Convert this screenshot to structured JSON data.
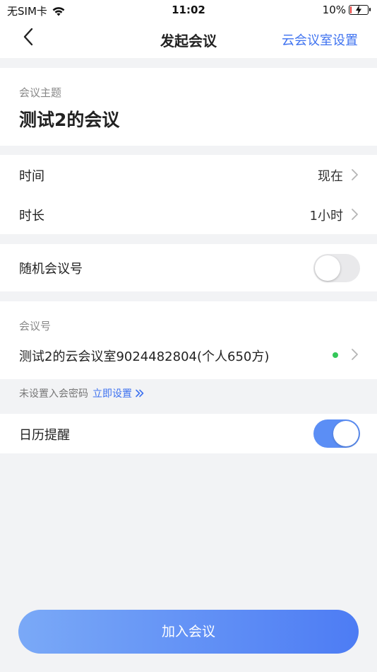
{
  "status_bar": {
    "carrier": "无SIM卡",
    "time": "11:02",
    "battery": "10%",
    "battery_level": 0.1
  },
  "nav": {
    "title": "发起会议",
    "action": "云会议室设置"
  },
  "topic": {
    "label": "会议主题",
    "value": "测试2的会议"
  },
  "schedule": {
    "time_label": "时间",
    "time_value": "现在",
    "duration_label": "时长",
    "duration_value": "1小时"
  },
  "random_id": {
    "label": "随机会议号",
    "enabled": false
  },
  "meeting_room": {
    "label": "会议号",
    "value": "测试2的云会议室9024482804(个人650方)"
  },
  "password": {
    "hint": "未设置入会密码",
    "link": "立即设置"
  },
  "calendar": {
    "label": "日历提醒",
    "enabled": true
  },
  "join_button": {
    "label": "加入会议"
  },
  "colors": {
    "accent": "#3e72f0",
    "background": "#f2f3f5",
    "status_dot": "#34c759"
  }
}
